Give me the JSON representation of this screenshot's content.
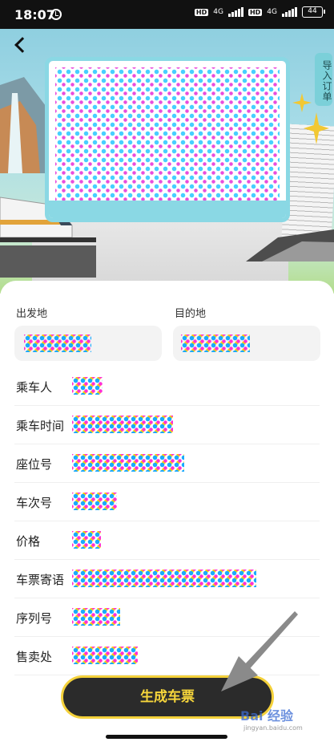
{
  "status_bar": {
    "time": "18:07",
    "hd_badge_1": "HD",
    "network_1": "4G",
    "hd_badge_2": "HD",
    "network_2": "4G",
    "battery": "44"
  },
  "header": {
    "back_icon": "chevron-left-icon",
    "import_order_label": "导入订单"
  },
  "form": {
    "departure_label": "出发地",
    "destination_label": "目的地",
    "rows": [
      {
        "label": "乘车人"
      },
      {
        "label": "乘车时间"
      },
      {
        "label": "座位号"
      },
      {
        "label": "车次号"
      },
      {
        "label": "价格"
      },
      {
        "label": "车票寄语"
      },
      {
        "label": "序列号"
      },
      {
        "label": "售卖处"
      }
    ]
  },
  "action": {
    "generate_label": "生成车票"
  },
  "watermark": {
    "text": "Bai 经验",
    "subtext": "jingyan.baidu.com"
  },
  "colors": {
    "button_bg": "#2b2b2b",
    "button_text": "#f7d63b",
    "accent_teal": "#8ad8e4",
    "input_bg": "#f3f3f3"
  }
}
